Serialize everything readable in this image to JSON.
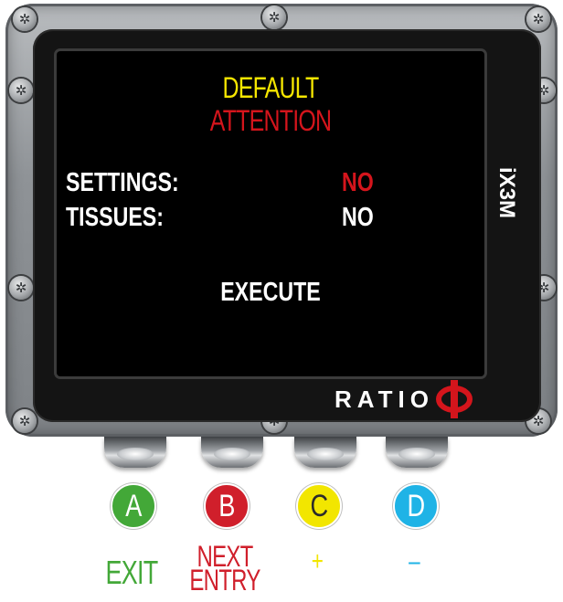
{
  "device": {
    "model": "iX3M",
    "brand": "RATIO"
  },
  "screen": {
    "title": "DEFAULT",
    "subtitle": "ATTENTION",
    "rows": [
      {
        "label": "SETTINGS:",
        "value": "NO",
        "value_color": "#d4151c"
      },
      {
        "label": "TISSUES:",
        "value": "NO",
        "value_color": "#ffffff"
      }
    ],
    "action": "EXECUTE"
  },
  "buttons": [
    {
      "letter": "A",
      "action": "EXIT",
      "color": "#43a838",
      "icon": "button-a-icon"
    },
    {
      "letter": "B",
      "action": "NEXT\nENTRY",
      "color": "#d01f2b",
      "icon": "button-b-icon"
    },
    {
      "letter": "C",
      "action": "+",
      "color": "#f2e600",
      "icon": "button-c-icon"
    },
    {
      "letter": "D",
      "action": "–",
      "color": "#1fb3e6",
      "icon": "button-d-icon"
    }
  ],
  "colors": {
    "title": "#f5e600",
    "attention": "#d4151c",
    "text": "#ffffff",
    "screen_bg": "#000000"
  }
}
